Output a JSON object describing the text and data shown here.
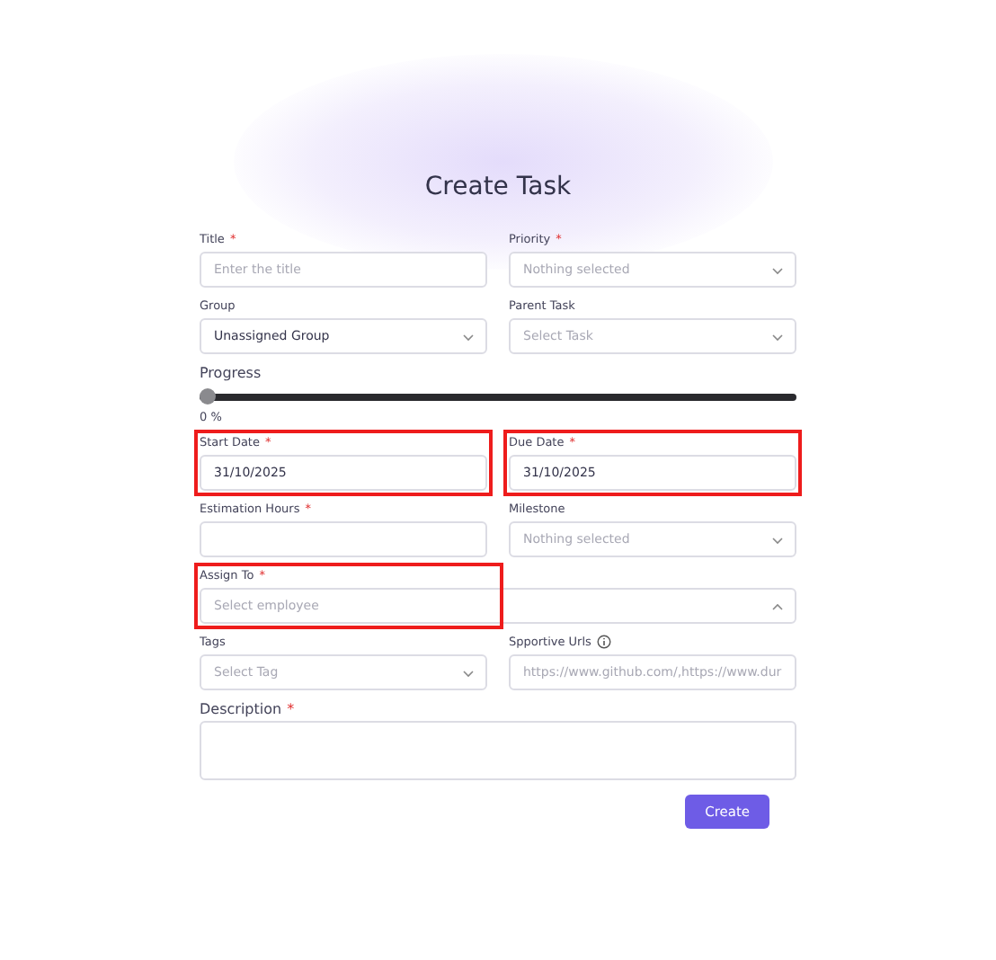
{
  "title": "Create Task",
  "rows": [
    {
      "fields": [
        {
          "kind": "text",
          "label": "Title",
          "mark": "*",
          "placeholder": "Enter the title",
          "highlighted": false
        },
        {
          "kind": "select",
          "label": "Priority",
          "mark": "*",
          "placeholder": "Nothing selected",
          "highlighted": false,
          "expanded": false
        }
      ]
    },
    {
      "fields": [
        {
          "kind": "select",
          "label": "Group",
          "value": "Unassigned Group",
          "highlighted": false,
          "expanded": false
        },
        {
          "kind": "select",
          "label": "Parent Task",
          "placeholder": "Select Task",
          "highlighted": false,
          "expanded": false
        }
      ]
    },
    {
      "fields": [
        {
          "kind": "slider",
          "label": "Progress",
          "level": 0,
          "reading": "0 %",
          "highlighted": false
        }
      ]
    },
    {
      "fields": [
        {
          "kind": "text",
          "label": "Start Date",
          "mark": "*",
          "value": "31/10/2025",
          "highlighted": true
        },
        {
          "kind": "text",
          "label": "Due Date",
          "mark": "*",
          "value": "31/10/2025",
          "highlighted": true
        }
      ]
    },
    {
      "fields": [
        {
          "kind": "text",
          "label": "Estimation Hours",
          "mark": "*",
          "highlighted": false
        },
        {
          "kind": "select",
          "label": "Milestone",
          "placeholder": "Nothing selected",
          "highlighted": false,
          "expanded": false
        }
      ]
    },
    {
      "fields": [
        {
          "kind": "select",
          "label": "Assign To",
          "mark": "*",
          "placeholder": "Select employee",
          "highlighted": true,
          "expanded": true
        }
      ]
    },
    {
      "fields": [
        {
          "kind": "select",
          "label": "Tags",
          "placeholder": "Select Tag",
          "highlighted": false,
          "expanded": false
        },
        {
          "kind": "text",
          "label": "Spportive Urls",
          "info": true,
          "placeholder": "https://www.github.com/,https://www.dur",
          "highlighted": false
        }
      ]
    },
    {
      "fields": [
        {
          "kind": "textarea",
          "label": "Description",
          "mark": "*",
          "highlighted": false
        }
      ]
    }
  ],
  "submit": "Create"
}
